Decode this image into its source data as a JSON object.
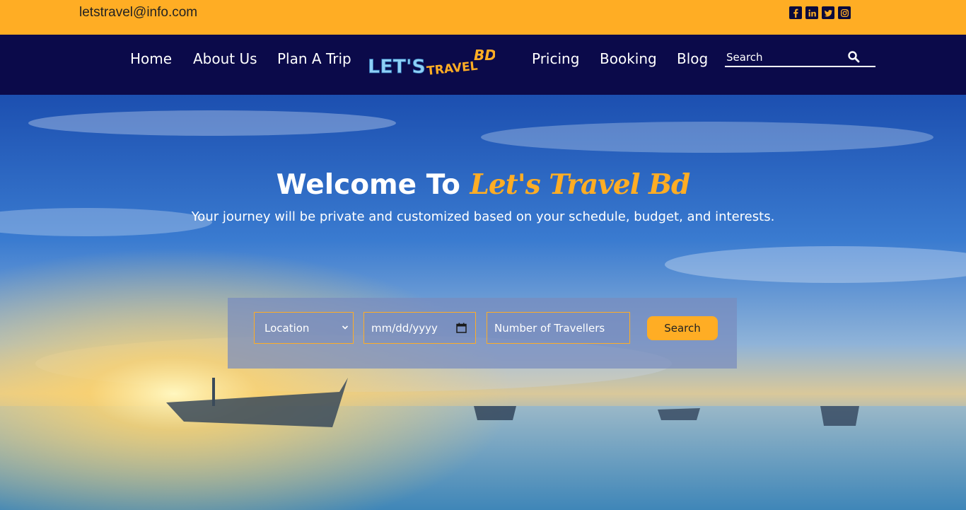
{
  "topbar": {
    "email": "letstravel@info.com",
    "social_icons": [
      "facebook-icon",
      "linkedin-icon",
      "twitter-icon",
      "instagram-icon"
    ]
  },
  "nav": {
    "items": [
      {
        "label": "Home"
      },
      {
        "label": "About Us"
      },
      {
        "label": "Plan A Trip"
      },
      {
        "label": "Pricing"
      },
      {
        "label": "Booking"
      },
      {
        "label": "Blog"
      }
    ],
    "logo_text_main": "LET'S",
    "logo_text_secondary": "TRAVEL",
    "logo_text_tag": "BD",
    "search_placeholder": "Search"
  },
  "hero": {
    "title_prefix": "Welcome To",
    "title_brand": "Let's Travel Bd",
    "subtitle": "Your journey will be private and customized based on your schedule, budget, and interests."
  },
  "booking": {
    "location_value": "Location",
    "date_placeholder": "mm/dd/yyyy",
    "travellers_placeholder": "Number of Travellers",
    "search_button": "Search"
  },
  "colors": {
    "accent": "#ffad24",
    "navy": "#0b0a4a"
  }
}
